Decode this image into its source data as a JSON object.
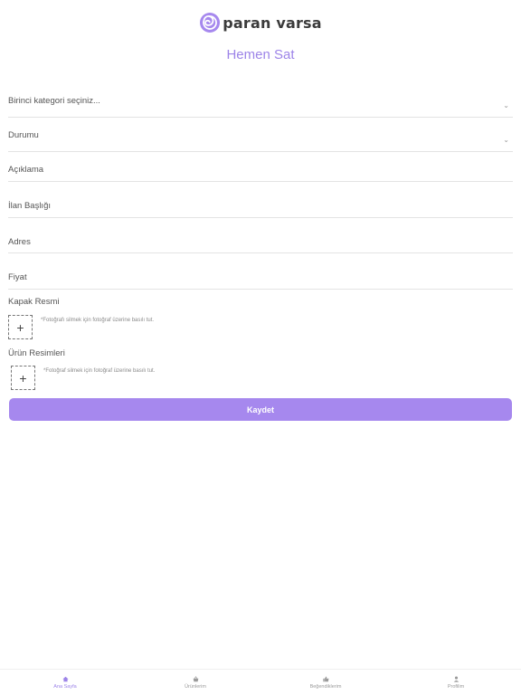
{
  "brand": {
    "name": "paran varsa",
    "accent": "#a688ee",
    "logo_icon": "spiral-logo-icon"
  },
  "header": {
    "title": "Hemen Sat"
  },
  "form": {
    "category": {
      "placeholder": "Birinci kategori seçiniz..."
    },
    "condition": {
      "placeholder": "Durumu"
    },
    "description": {
      "placeholder": "Açıklama"
    },
    "listing_title": {
      "placeholder": "İlan Başlığı"
    },
    "address": {
      "placeholder": "Adres"
    },
    "price": {
      "placeholder": "Fiyat"
    },
    "cover_image": {
      "label": "Kapak Resmi",
      "add_symbol": "+",
      "hint": "*Fotoğrafı silmek için fotoğraf üzerine basılı tut."
    },
    "product_images": {
      "label": "Ürün Resimleri",
      "add_symbol": "+",
      "hint": "*Fotoğraf silmek için fotoğraf üzerine basılı tut."
    },
    "save_label": "Kaydet"
  },
  "tabbar": {
    "items": [
      {
        "label": "Ana Sayfa",
        "icon": "home-icon",
        "active": true
      },
      {
        "label": "Ürünlerim",
        "icon": "basket-icon",
        "active": false
      },
      {
        "label": "Beğendiklerim",
        "icon": "thumbs-up-icon",
        "active": false
      },
      {
        "label": "Profilim",
        "icon": "user-icon",
        "active": false
      }
    ]
  }
}
